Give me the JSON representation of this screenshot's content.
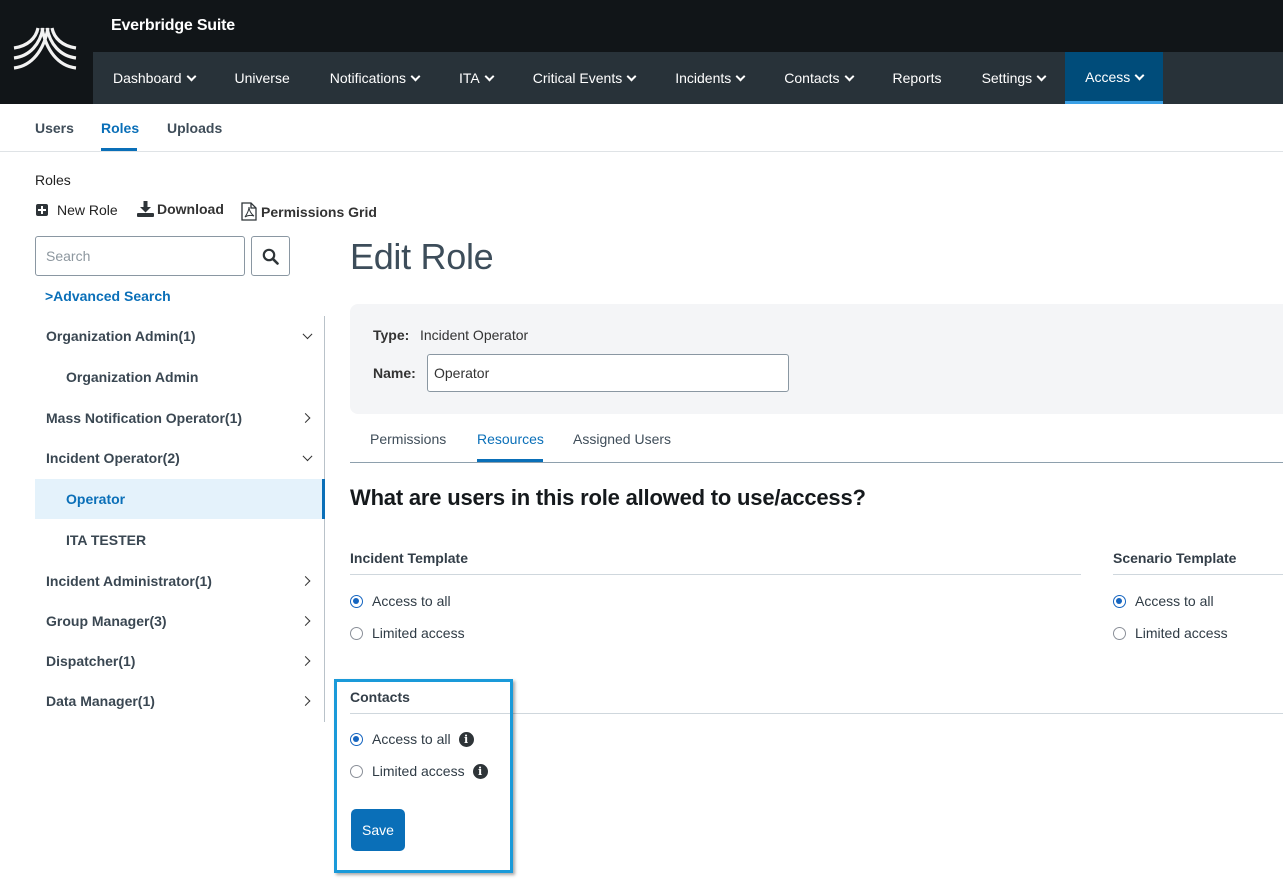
{
  "app": {
    "title": "Everbridge Suite",
    "accent_color": "#0a6fb8",
    "active_nav_color": "#004c7a"
  },
  "nav": {
    "items": [
      {
        "label": "Dashboard",
        "dropdown": true
      },
      {
        "label": "Universe",
        "dropdown": false
      },
      {
        "label": "Notifications",
        "dropdown": true
      },
      {
        "label": "ITA",
        "dropdown": true
      },
      {
        "label": "Critical Events",
        "dropdown": true
      },
      {
        "label": "Incidents",
        "dropdown": true
      },
      {
        "label": "Contacts",
        "dropdown": true
      },
      {
        "label": "Reports",
        "dropdown": false
      },
      {
        "label": "Settings",
        "dropdown": true
      },
      {
        "label": "Access",
        "dropdown": true,
        "active": true
      }
    ]
  },
  "subtabs": {
    "items": [
      {
        "label": "Users"
      },
      {
        "label": "Roles",
        "active": true
      },
      {
        "label": "Uploads"
      }
    ]
  },
  "sidebar": {
    "heading": "Roles",
    "toolbar": {
      "new_role": "New Role",
      "download": "Download",
      "permissions_grid": "Permissions Grid"
    },
    "search": {
      "placeholder": "Search",
      "value": ""
    },
    "advanced_search": ">Advanced Search",
    "tree": [
      {
        "label": "Organization Admin(1)",
        "type": "group",
        "expanded": true
      },
      {
        "label": "Organization Admin",
        "type": "child"
      },
      {
        "label": "Mass Notification Operator(1)",
        "type": "group",
        "expanded": false
      },
      {
        "label": "Incident Operator(2)",
        "type": "group",
        "expanded": true
      },
      {
        "label": "Operator",
        "type": "child",
        "selected": true
      },
      {
        "label": "ITA TESTER",
        "type": "child"
      },
      {
        "label": "Incident Administrator(1)",
        "type": "group",
        "expanded": false
      },
      {
        "label": "Group Manager(3)",
        "type": "group",
        "expanded": false
      },
      {
        "label": "Dispatcher(1)",
        "type": "group",
        "expanded": false
      },
      {
        "label": "Data Manager(1)",
        "type": "group",
        "expanded": false
      }
    ]
  },
  "main": {
    "title": "Edit Role",
    "type_label": "Type:",
    "type_value": "Incident Operator",
    "name_label": "Name:",
    "name_value": "Operator",
    "tabs": [
      {
        "label": "Permissions"
      },
      {
        "label": "Resources",
        "active": true
      },
      {
        "label": "Assigned Users"
      }
    ],
    "question": "What are users in this role allowed to use/access?",
    "sections": {
      "incident_template": {
        "title": "Incident Template",
        "options": [
          "Access to all",
          "Limited access"
        ],
        "selected": "Access to all"
      },
      "scenario_template": {
        "title": "Scenario Template",
        "options": [
          "Access to all",
          "Limited access"
        ],
        "selected": "Access to all"
      },
      "contacts": {
        "title": "Contacts",
        "options": [
          "Access to all",
          "Limited access"
        ],
        "selected": "Access to all"
      }
    },
    "save_label": "Save"
  }
}
